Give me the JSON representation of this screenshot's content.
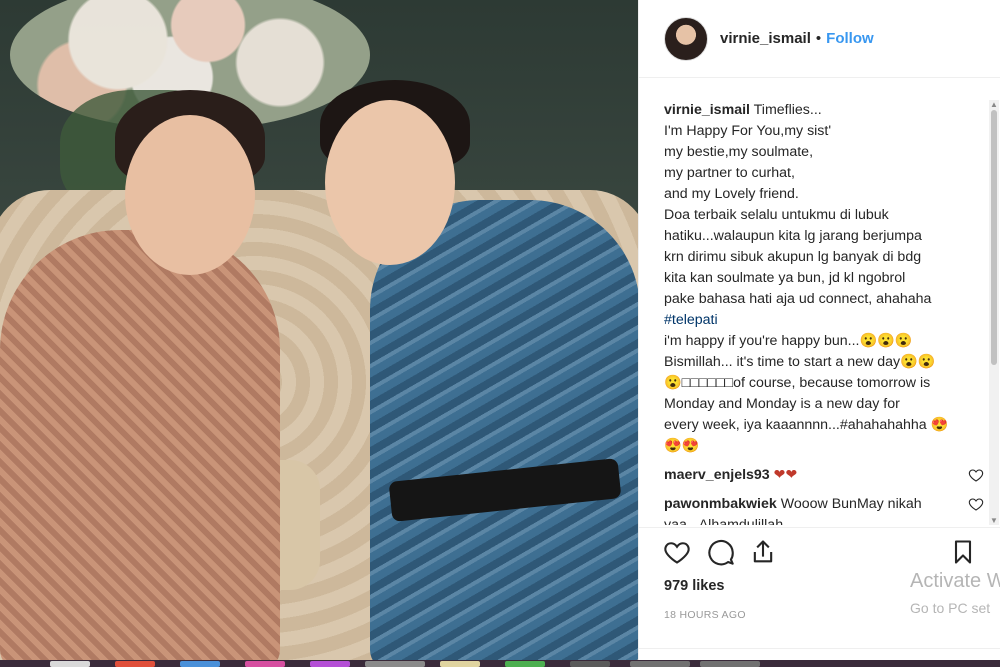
{
  "post": {
    "username": "virnie_ismail",
    "separator": "•",
    "follow_label": "Follow"
  },
  "caption": {
    "username": "virnie_ismail",
    "lines": [
      "Timeflies...",
      "I'm Happy For You,my sist'",
      "my bestie,my soulmate,",
      "my partner to curhat,",
      "and my Lovely friend.",
      "Doa terbaik selalu untukmu di lubuk",
      "hatiku...walaupun kita lg jarang berjumpa",
      "krn dirimu sibuk akupun lg banyak di bdg",
      "kita kan soulmate ya bun, jd kl ngobrol",
      "pake bahasa hati aja ud connect, ahahaha",
      "#telepati",
      "i'm happy if you're happy bun...😮😮😮",
      "Bismillah... it's time to start a new day😮😮",
      "😮□□□□□□of course, because tomorrow is",
      "Monday and Monday is a new day for",
      "every week, iya kaaannnn...#ahahahahha 😍",
      "😍😍"
    ]
  },
  "comments": [
    {
      "username": "maerv_enjels93",
      "text": "❤❤"
    },
    {
      "username": "pawonmbakwiek",
      "text": "Wooow BunMay nikah yaa...Alhamdulillah"
    }
  ],
  "actions": {
    "likes": "979 likes",
    "timestamp": "18 HOURS AGO"
  },
  "overlay": {
    "activate_title": "Activate W",
    "activate_sub": "Go to PC set"
  },
  "colors": {
    "link_blue": "#3897f0",
    "text": "#262626",
    "muted": "#999999",
    "heart_red": "#c0392b"
  },
  "icons": [
    "heart-icon",
    "comment-icon",
    "share-icon",
    "bookmark-icon"
  ]
}
